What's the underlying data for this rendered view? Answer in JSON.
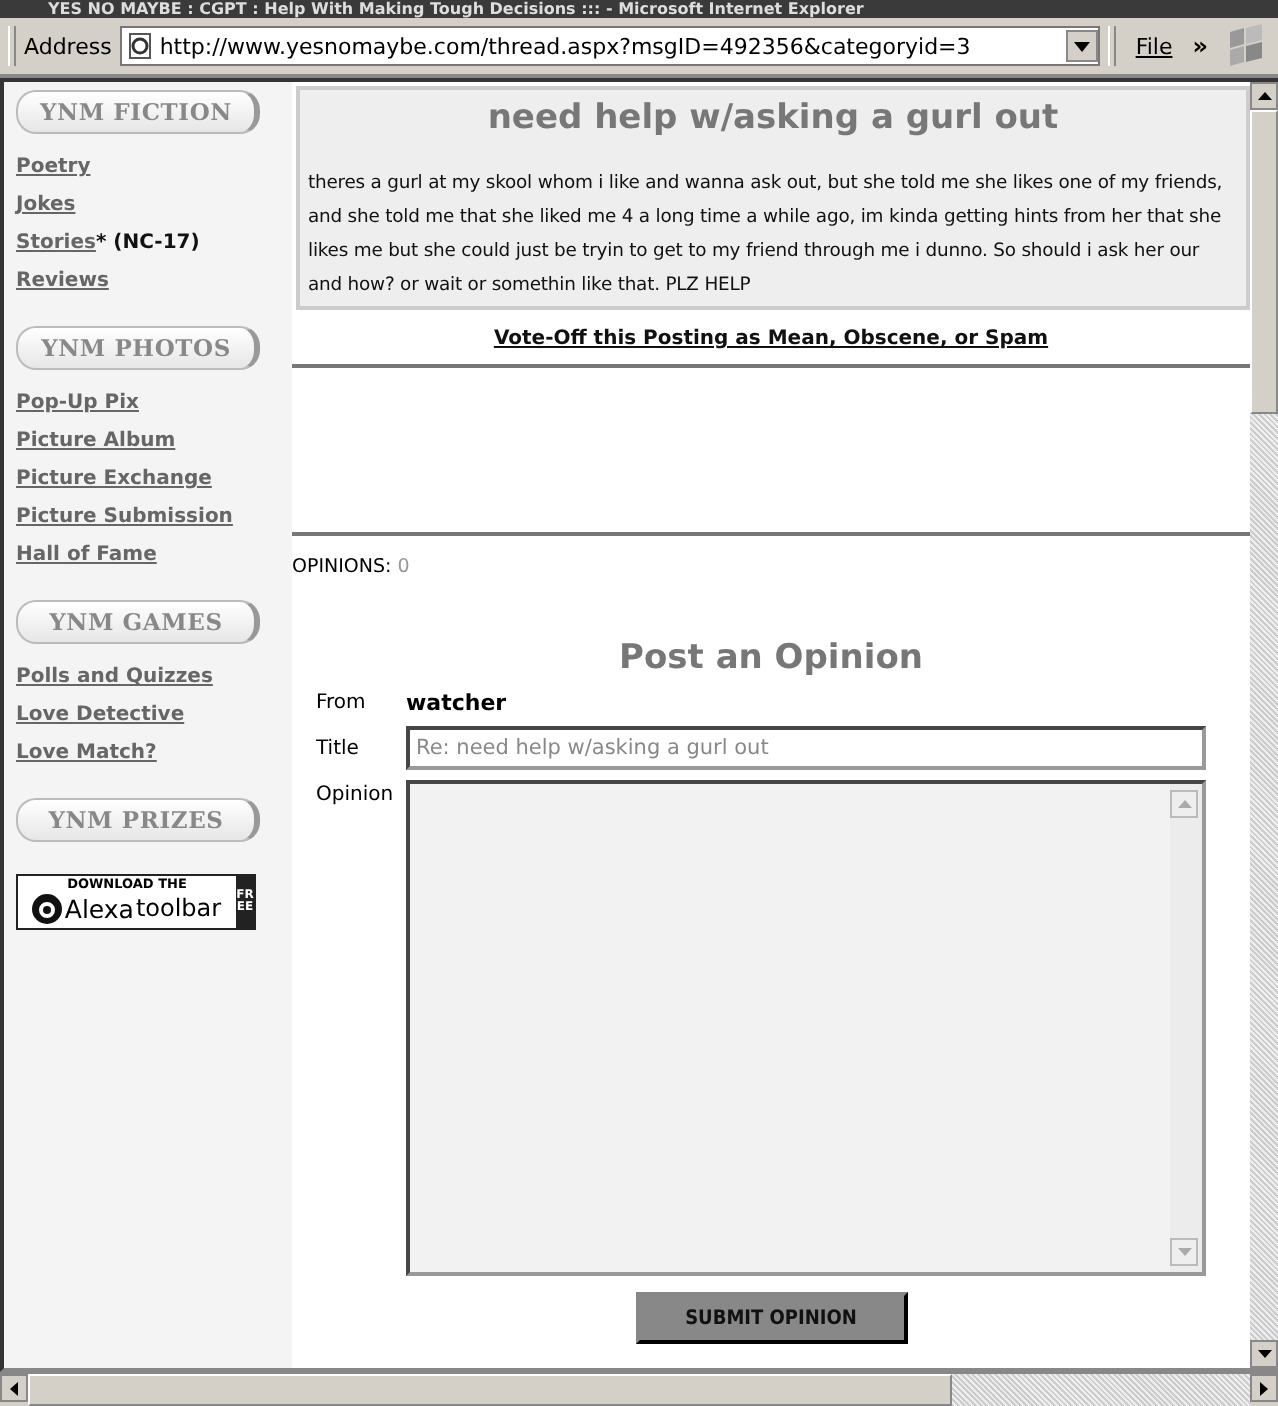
{
  "window": {
    "title": "YES NO MAYBE : CGPT : Help With Making Tough Decisions ::: - Microsoft Internet Explorer"
  },
  "address_bar": {
    "label": "Address",
    "url": "http://www.yesnomaybe.com/thread.aspx?msgID=492356&categoryid=3",
    "menu": "File",
    "more": "»"
  },
  "sidebar": {
    "sections": [
      {
        "heading": "YNM FICTION",
        "links": [
          {
            "label": "Poetry"
          },
          {
            "label": "Jokes"
          },
          {
            "label": "Stories",
            "note": "* (NC-17)"
          },
          {
            "label": "Reviews"
          }
        ]
      },
      {
        "heading": "YNM PHOTOS",
        "links": [
          {
            "label": "Pop-Up Pix"
          },
          {
            "label": "Picture Album"
          },
          {
            "label": "Picture Exchange"
          },
          {
            "label": "Picture Submission"
          },
          {
            "label": "Hall of Fame"
          }
        ]
      },
      {
        "heading": "YNM GAMES",
        "links": [
          {
            "label": "Polls and Quizzes"
          },
          {
            "label": "Love Detective"
          },
          {
            "label": "Love Match?"
          }
        ]
      },
      {
        "heading": "YNM PRIZES"
      }
    ],
    "banner": {
      "top": "DOWNLOAD THE",
      "brand": "Alexa",
      "product": "toolbar",
      "side": "FREE"
    }
  },
  "post": {
    "title": "need help w/asking a gurl out",
    "body": "theres a gurl at my skool whom i like and wanna ask out, but she told me she likes one of my friends, and she told me that she liked me 4 a long time a while ago, im kinda getting hints from her that she likes me but she could just be tryin to get to my friend through me i dunno. So should i ask her our and how? or wait or somethin like that. PLZ HELP",
    "vote_link": "Vote-Off this Posting as Mean, Obscene, or Spam"
  },
  "opinions": {
    "label": "OPINIONS:",
    "count": "0"
  },
  "form": {
    "heading": "Post an Opinion",
    "from_label": "From",
    "from_value": "watcher",
    "title_label": "Title",
    "title_value": "Re: need help w/asking a gurl out",
    "opinion_label": "Opinion",
    "submit": "SUBMIT OPINION"
  }
}
